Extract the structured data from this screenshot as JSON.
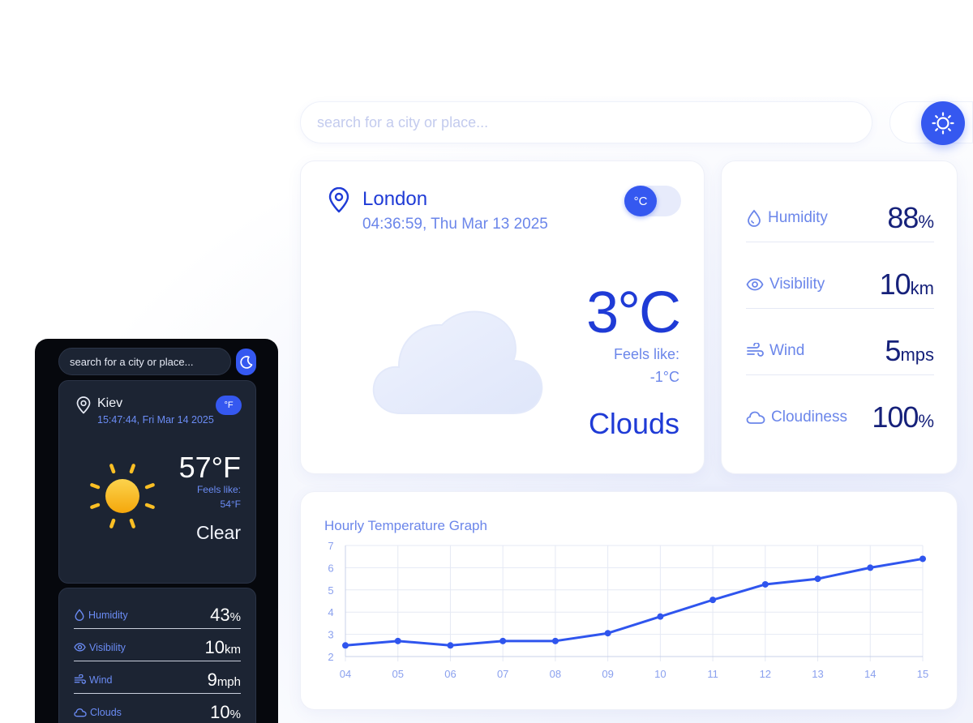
{
  "light": {
    "search": {
      "placeholder": "search for a city or place..."
    },
    "theme_icon": "sun-icon",
    "current": {
      "city": "London",
      "datetime": "04:36:59, Thu Mar 13 2025",
      "unit_toggle": "°C",
      "temperature": "3°C",
      "feels_like_label": "Feels like:",
      "feels_like_value": "-1°C",
      "condition": "Clouds",
      "condition_icon": "cloud-icon"
    },
    "stats": [
      {
        "icon": "droplet-icon",
        "label": "Humidity",
        "value": "88",
        "unit": "%"
      },
      {
        "icon": "eye-icon",
        "label": "Visibility",
        "value": "10",
        "unit": "km"
      },
      {
        "icon": "wind-icon",
        "label": "Wind",
        "value": "5",
        "unit": "mps"
      },
      {
        "icon": "cloud-icon",
        "label": "Cloudiness",
        "value": "100",
        "unit": "%"
      }
    ],
    "graph": {
      "title": "Hourly Temperature Graph"
    }
  },
  "dark": {
    "search": {
      "placeholder": "search for a city or place..."
    },
    "theme_icon": "moon-icon",
    "current": {
      "city": "Kiev",
      "datetime": "15:47:44, Fri Mar 14 2025",
      "unit_toggle": "°F",
      "temperature": "57°F",
      "feels_like_label": "Feels like:",
      "feels_like_value": "54°F",
      "condition": "Clear",
      "condition_icon": "sun-icon"
    },
    "stats": [
      {
        "icon": "droplet-icon",
        "label": "Humidity",
        "value": "43",
        "unit": "%"
      },
      {
        "icon": "eye-icon",
        "label": "Visibility",
        "value": "10",
        "unit": "km"
      },
      {
        "icon": "wind-icon",
        "label": "Wind",
        "value": "9",
        "unit": "mph"
      },
      {
        "icon": "cloud-icon",
        "label": "Clouds",
        "value": "10",
        "unit": "%"
      }
    ]
  },
  "colors": {
    "accent": "#3558f0",
    "primary_text": "#1f3bd6",
    "secondary_text": "#6b86ea",
    "dark_bg": "#06080d",
    "dark_card": "#1c2433",
    "sun": "#fbbf24"
  },
  "chart_data": {
    "type": "line",
    "title": "Hourly Temperature Graph",
    "xlabel": "",
    "ylabel": "",
    "categories": [
      "04",
      "05",
      "06",
      "07",
      "08",
      "09",
      "10",
      "11",
      "12",
      "13",
      "14",
      "15"
    ],
    "series": [
      {
        "values": [
          2.5,
          2.7,
          2.5,
          2.7,
          2.7,
          3.05,
          3.8,
          4.55,
          5.25,
          5.5,
          6.0,
          6.4
        ]
      }
    ],
    "ylim": [
      2,
      7
    ],
    "yticks": [
      2,
      3,
      4,
      5,
      6,
      7
    ],
    "grid": true,
    "legend": "none"
  }
}
